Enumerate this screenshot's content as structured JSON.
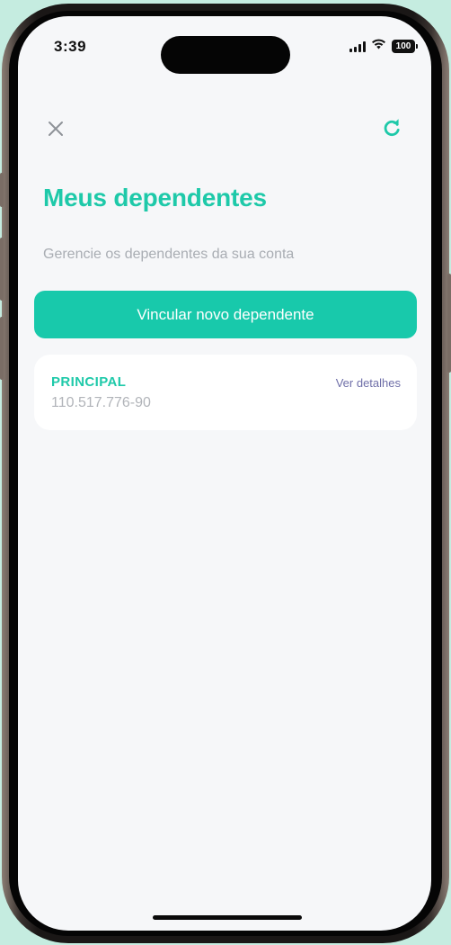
{
  "status_bar": {
    "time": "3:39",
    "battery": "100"
  },
  "header": {
    "close_icon": "close-icon",
    "refresh_icon": "refresh-icon"
  },
  "page": {
    "title": "Meus dependentes",
    "subtitle": "Gerencie os dependentes da sua conta",
    "add_button_label": "Vincular novo dependente"
  },
  "dependents": [
    {
      "name": "PRINCIPAL",
      "cpf": "110.517.776-90",
      "details_label": "Ver detalhes"
    }
  ],
  "colors": {
    "accent": "#18c9ab",
    "title": "#1ec9a9",
    "link": "#6f6fa8",
    "muted_text": "#a9adb3",
    "screen_background": "#f6f7f9",
    "page_background": "#c5ece0"
  }
}
